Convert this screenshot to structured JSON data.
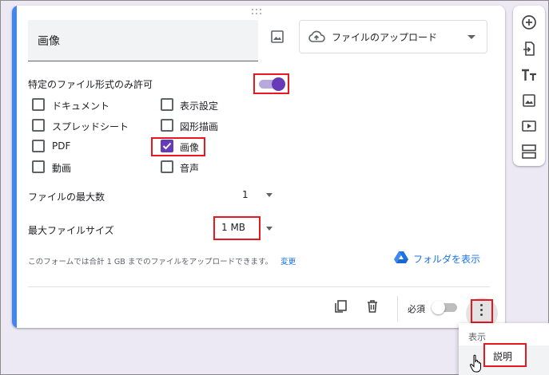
{
  "question": {
    "title": "画像",
    "type_selector": "ファイルのアップロード"
  },
  "restrict_types": {
    "label": "特定のファイル形式のみ許可",
    "enabled": true
  },
  "file_types": [
    {
      "label": "ドキュメント",
      "checked": false
    },
    {
      "label": "表示設定",
      "checked": false
    },
    {
      "label": "スプレッドシート",
      "checked": false
    },
    {
      "label": "図形描画",
      "checked": false
    },
    {
      "label": "PDF",
      "checked": false
    },
    {
      "label": "画像",
      "checked": true
    },
    {
      "label": "動画",
      "checked": false
    },
    {
      "label": "音声",
      "checked": false
    }
  ],
  "max_files": {
    "label": "ファイルの最大数",
    "value": "1"
  },
  "max_size": {
    "label": "最大ファイルサイズ",
    "value": "1 MB"
  },
  "limit_note": "このフォームでは合計 1 GB までのファイルをアップロードできます。",
  "change_link": "変更",
  "show_folder_link": "フォルダを表示",
  "footer": {
    "required_label": "必須",
    "required_enabled": false
  },
  "menu": {
    "header": "表示",
    "item": "説明"
  },
  "colors": {
    "accent": "#673ab7",
    "card_accent": "#4285f4",
    "link": "#1a73e8",
    "highlight_box": "#e8191e",
    "background": "#ece9f5"
  },
  "icons": [
    "image-icon",
    "cloud-upload-icon",
    "google-drive-icon",
    "copy-icon",
    "trash-icon",
    "more-vert-icon",
    "add-circle-icon",
    "import-icon",
    "title-icon",
    "add-image-icon",
    "add-video-icon",
    "add-section-icon",
    "hand-pointer-icon"
  ]
}
